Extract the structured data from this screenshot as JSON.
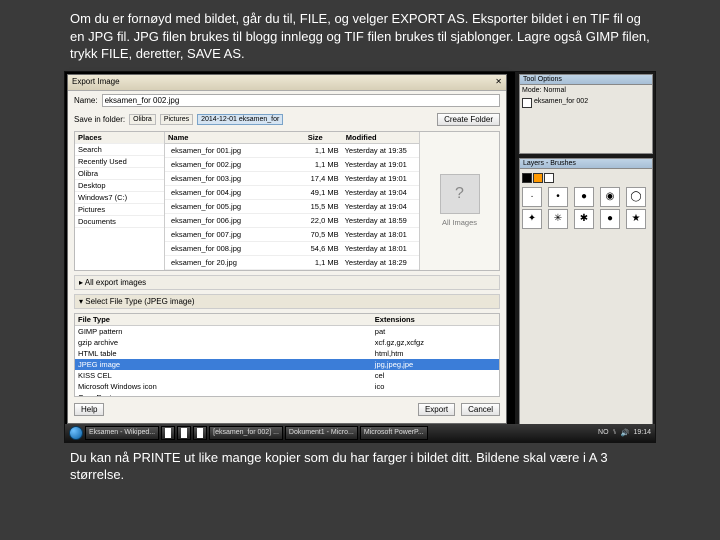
{
  "paragraph_top": "Om du er fornøyd med bildet, går du til, FILE, og velger EXPORT AS. Eksporter bildet i en TIF fil og en JPG fil. JPG filen brukes til blogg innlegg og TIF filen brukes til sjablonger. Lagre også GIMP filen, trykk FILE, deretter, SAVE AS.",
  "paragraph_bottom": "Du kan nå PRINTE ut like mange kopier som du har farger i bildet ditt. Bildene skal være i A 3 størrelse.",
  "dialog": {
    "title": "Export Image",
    "name_label": "Name:",
    "filename": "eksamen_for 002.jpg",
    "save_in_label": "Save in folder:",
    "create_folder": "Create Folder",
    "crumbs": [
      "Olibra",
      "Pictures",
      "2014-12-01 eksamen_for"
    ],
    "places_header": "Places",
    "places": [
      "Search",
      "Recently Used",
      "Olibra",
      "Desktop",
      "Windows7 (C:)",
      "Pictures",
      "Documents"
    ],
    "file_headers": [
      "Name",
      "Size",
      "Modified"
    ],
    "files": [
      {
        "n": "eksamen_for 001.jpg",
        "s": "1,1 MB",
        "m": "Yesterday at 19:35"
      },
      {
        "n": "eksamen_for 002.jpg",
        "s": "1,1 MB",
        "m": "Yesterday at 19:01"
      },
      {
        "n": "eksamen_for 003.jpg",
        "s": "17,4 MB",
        "m": "Yesterday at 19:01"
      },
      {
        "n": "eksamen_for 004.jpg",
        "s": "49,1 MB",
        "m": "Yesterday at 19:04"
      },
      {
        "n": "eksamen_for 005.jpg",
        "s": "15,5 MB",
        "m": "Yesterday at 19:04"
      },
      {
        "n": "eksamen_for 006.jpg",
        "s": "22,0 MB",
        "m": "Yesterday at 18:59"
      },
      {
        "n": "eksamen_for 007.jpg",
        "s": "70,5 MB",
        "m": "Yesterday at 18:01"
      },
      {
        "n": "eksamen_for 008.jpg",
        "s": "54,6 MB",
        "m": "Yesterday at 18:01"
      },
      {
        "n": "eksamen_for 20.jpg",
        "s": "1,1 MB",
        "m": "Yesterday at 18:29"
      }
    ],
    "preview_label": "All Images",
    "all_export": "All export images",
    "select_type": "Select File Type (JPEG image)",
    "type_headers": [
      "File Type",
      "Extensions"
    ],
    "types": [
      {
        "t": "GIMP pattern",
        "e": "pat"
      },
      {
        "t": "gzip archive",
        "e": "xcf.gz,gz,xcfgz"
      },
      {
        "t": "HTML table",
        "e": "html,htm"
      },
      {
        "t": "JPEG image",
        "e": "jpg,jpeg,jpe"
      },
      {
        "t": "KISS CEL",
        "e": "cel"
      },
      {
        "t": "Microsoft Windows icon",
        "e": "ico"
      },
      {
        "t": "OpenRaster",
        "e": "ora"
      }
    ],
    "type_selected_index": 3,
    "help": "Help",
    "export": "Export",
    "cancel": "Cancel"
  },
  "panels": {
    "p1_title": "Tool Options",
    "p2_title": "Layers - Brushes",
    "mode_label": "Mode: Normal",
    "thumb_label": "eksamen_for 002"
  },
  "taskbar": {
    "items": [
      "Eksamen - Wikiped...",
      "",
      "",
      "",
      "[eksamen_for 002] ...",
      "Dokument1 - Micro...",
      "Microsoft PowerP..."
    ],
    "lang": "NO",
    "time": "19:14"
  }
}
